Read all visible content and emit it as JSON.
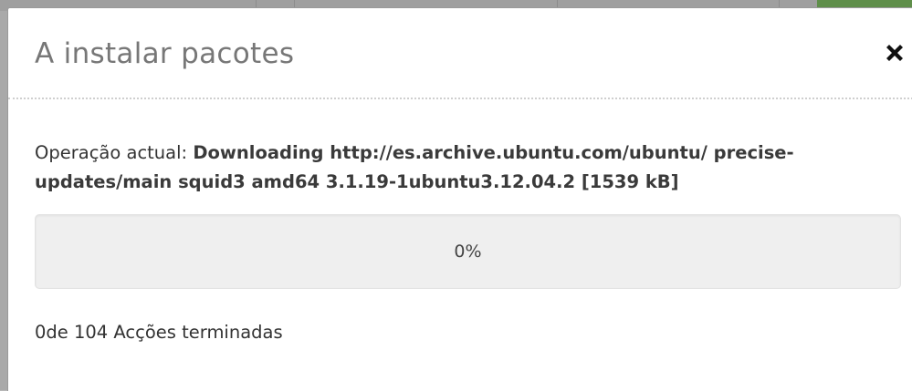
{
  "dialog": {
    "title": "A instalar pacotes",
    "close_icon": "close-icon"
  },
  "operation": {
    "label": "Operação actual:",
    "value": "Downloading http://es.archive.ubuntu.com/ubuntu/ precise-updates/main squid3 amd64 3.1.19-1ubuntu3.12.04.2 [1539 kB]"
  },
  "progress": {
    "percent": 0,
    "text": "0%"
  },
  "status": {
    "text": "0de 104 Acções terminadas"
  },
  "colors": {
    "accent": "#5f8f4a",
    "title": "#777777",
    "text": "#333333"
  }
}
